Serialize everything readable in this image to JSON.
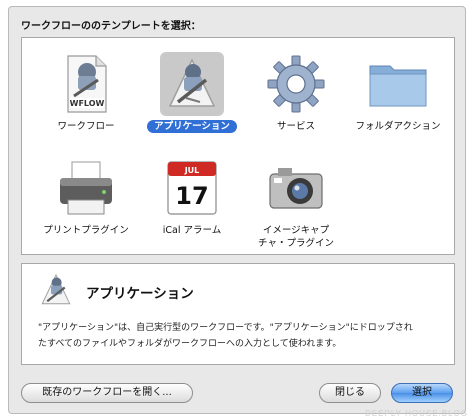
{
  "dialog": {
    "prompt": "ワークフローののテンプレートを選択："
  },
  "templates": [
    {
      "label": "ワークフロー",
      "icon": "wflow-document-icon",
      "icon_text": "WFLOW",
      "selected": false
    },
    {
      "label": "アプリケーション",
      "icon": "automator-application-icon",
      "selected": true
    },
    {
      "label": "サービス",
      "icon": "gear-icon",
      "selected": false
    },
    {
      "label": "フォルダアクション",
      "icon": "folder-icon",
      "selected": false
    },
    {
      "label": "プリントプラグイン",
      "icon": "printer-icon",
      "selected": false
    },
    {
      "label": "iCal アラーム",
      "icon": "calendar-icon",
      "icon_month": "JUL",
      "icon_day": "17",
      "selected": false
    },
    {
      "label_line1": "イメージキャプ",
      "label_line2": "チャ・プラグイン",
      "icon": "camera-icon",
      "selected": false
    }
  ],
  "description": {
    "title": "アプリケーション",
    "line1": "\"アプリケーション\"は、自己実行型のワークフローです。\"アプリケーション\"にドロップされ",
    "line2": "たすべてのファイルやフォルダがワークフローへの入力として使われます。"
  },
  "buttons": {
    "open_existing": "既存のワークフローを開く...",
    "close": "閉じる",
    "choose": "選択"
  },
  "colors": {
    "selection": "#2f6fd6",
    "sheet_background": "#e8e8e8",
    "primary_button": "#5c9ff0"
  },
  "watermark": "DEEPLY HOUSE.BLOG"
}
